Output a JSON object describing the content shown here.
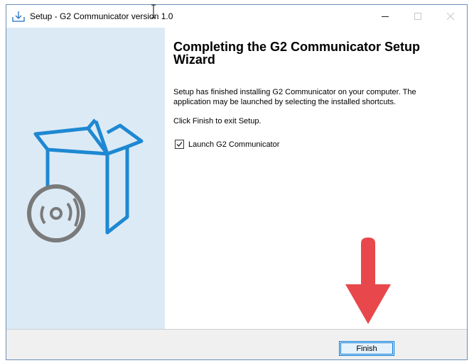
{
  "window": {
    "title": "Setup - G2 Communicator version 1.0",
    "icons": {
      "app": "installer-download-icon",
      "minimize": "minimize-icon",
      "maximize": "maximize-icon",
      "close": "close-icon"
    }
  },
  "sidebar": {
    "image": "box-with-disc-icon"
  },
  "main": {
    "heading": "Completing the G2 Communicator Setup Wizard",
    "description": "Setup has finished installing G2 Communicator on your computer. The application may be launched by selecting the installed shortcuts.",
    "click_finish": "Click Finish to exit Setup.",
    "launch_checkbox": {
      "label": "Launch G2 Communicator",
      "checked": true
    }
  },
  "footer": {
    "finish_label": "Finish"
  },
  "annotation": {
    "arrow": "red-down-arrow-icon"
  },
  "colors": {
    "sidebar_bg": "#dceaf6",
    "accent_blue": "#1e88d2",
    "arrow_red": "#e8484c"
  }
}
